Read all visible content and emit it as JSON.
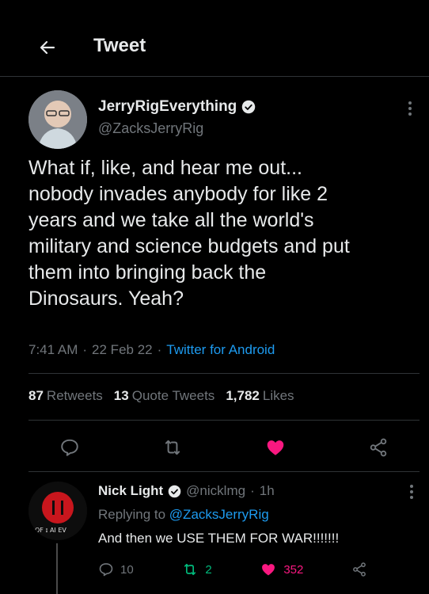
{
  "header": {
    "title": "Tweet"
  },
  "tweet": {
    "author": {
      "name": "JerryRigEverything",
      "handle": "@ZacksJerryRig"
    },
    "text": "What if, like, and hear me out...\nnobody invades anybody for like 2\nyears and we take all the world's\nmilitary and science budgets and put\nthem into bringing back the\nDinosaurs. Yeah?",
    "time": "7:41 AM",
    "date": "22 Feb 22",
    "source": "Twitter for Android",
    "stats": [
      {
        "count": "87",
        "label": "Retweets"
      },
      {
        "count": "13",
        "label": "Quote Tweets"
      },
      {
        "count": "1,782",
        "label": "Likes"
      }
    ]
  },
  "reply": {
    "name": "Nick Light",
    "handle": "@nicklmg",
    "time": "1h",
    "replying_to_prefix": "Replying to",
    "replying_to_handle": "@ZacksJerryRig",
    "text": "And then we USE THEM FOR WAR!!!!!!!",
    "counts": {
      "replies": "10",
      "retweets": "2",
      "likes": "352"
    }
  },
  "colors": {
    "accent": "#1d9bf0",
    "like": "#f91880",
    "retweet": "#00ba7c"
  }
}
